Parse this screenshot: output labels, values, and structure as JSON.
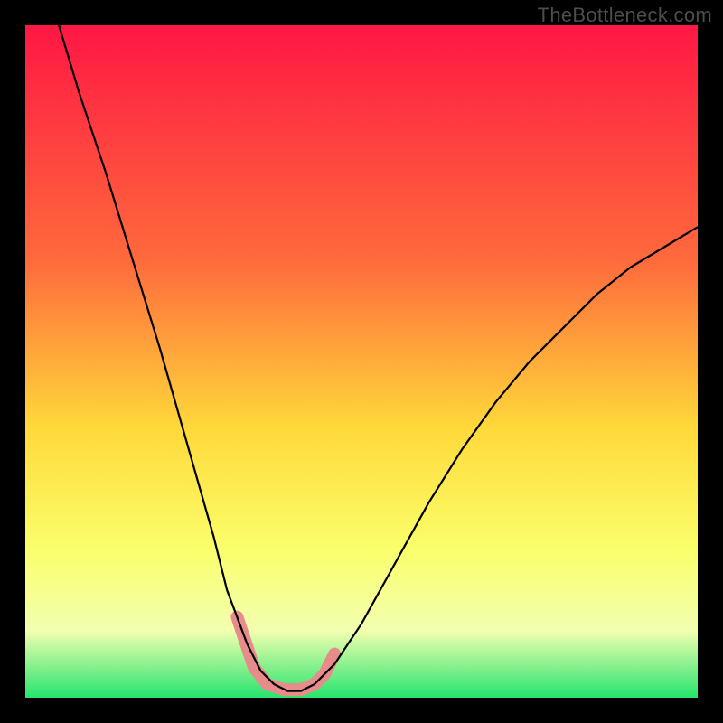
{
  "watermark": "TheBottleneck.com",
  "chart_data": {
    "type": "line",
    "title": "",
    "xlabel": "",
    "ylabel": "",
    "xlim": [
      0,
      100
    ],
    "ylim": [
      0,
      100
    ],
    "background_gradient": {
      "top": "#FF1744",
      "upper_mid": "#FF6A3C",
      "mid": "#FFD93A",
      "lower_mid": "#FAFF6B",
      "band_light": "#F2FFB0",
      "bottom": "#27E46E"
    },
    "series": [
      {
        "name": "curve",
        "color": "#000000",
        "x": [
          0,
          5,
          8,
          12,
          16,
          20,
          24,
          28,
          30,
          33,
          35,
          37,
          39,
          41,
          43,
          46,
          50,
          55,
          60,
          65,
          70,
          75,
          80,
          85,
          90,
          95,
          100
        ],
        "y": [
          115,
          100,
          90,
          78,
          65,
          52,
          38,
          24,
          16,
          8,
          4,
          2,
          1,
          1,
          2,
          5,
          11,
          20,
          29,
          37,
          44,
          50,
          55,
          60,
          64,
          67,
          70
        ]
      },
      {
        "name": "ideal-band",
        "type": "marker-path",
        "color": "#E88B8B",
        "stroke_width": 14,
        "points": [
          {
            "x": 31.5,
            "y": 12.0
          },
          {
            "x": 32.5,
            "y": 9.0
          },
          {
            "x": 34.0,
            "y": 4.5
          },
          {
            "x": 36.0,
            "y": 2.0
          },
          {
            "x": 38.5,
            "y": 1.2
          },
          {
            "x": 41.0,
            "y": 1.2
          },
          {
            "x": 43.0,
            "y": 2.0
          },
          {
            "x": 44.5,
            "y": 3.5
          },
          {
            "x": 46.0,
            "y": 6.5
          }
        ]
      }
    ]
  }
}
